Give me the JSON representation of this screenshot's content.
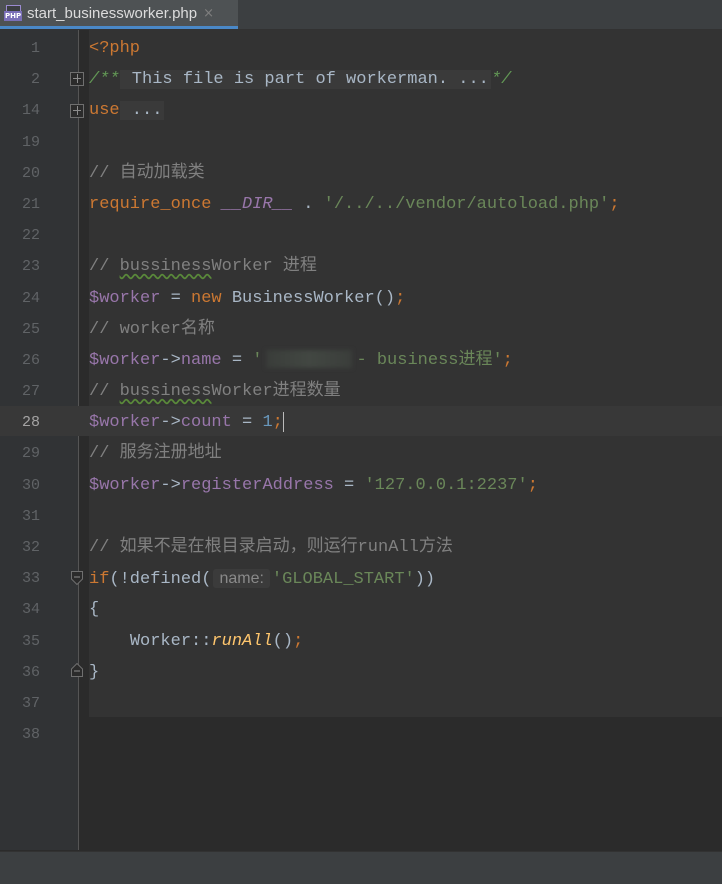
{
  "tab": {
    "file_icon": "php-file-icon",
    "icon_label": "PHP",
    "title": "start_businessworker.php",
    "close": "×"
  },
  "editor": {
    "current_line": "28",
    "lines": [
      {
        "num": "1"
      },
      {
        "num": "2"
      },
      {
        "num": "14"
      },
      {
        "num": "19"
      },
      {
        "num": "20"
      },
      {
        "num": "21"
      },
      {
        "num": "22"
      },
      {
        "num": "23"
      },
      {
        "num": "24"
      },
      {
        "num": "25"
      },
      {
        "num": "26"
      },
      {
        "num": "27"
      },
      {
        "num": "28"
      },
      {
        "num": "29"
      },
      {
        "num": "30"
      },
      {
        "num": "31"
      },
      {
        "num": "32"
      },
      {
        "num": "33"
      },
      {
        "num": "34"
      },
      {
        "num": "35"
      },
      {
        "num": "36"
      },
      {
        "num": "37"
      },
      {
        "num": "38"
      }
    ],
    "code": {
      "l1": "<?php",
      "l2_open": "/**",
      "l2_text": " This file is part of workerman. ...",
      "l2_close": "*/",
      "l3_kw": "use",
      "l3_fold": " ...",
      "l5": "// 自动加载类",
      "l6_kw": "require_once",
      "l6_const": "__DIR__",
      "l6_dot": " . ",
      "l6_str": "'/../../vendor/autoload.php'",
      "l6_semi": ";",
      "l8_pre": "// ",
      "l8_squig": "bussiness",
      "l8_post": "Worker 进程",
      "l9_var": "$worker",
      "l9_eq": " = ",
      "l9_new": "new",
      "l9_cls": " BusinessWorker()",
      "l9_semi": ";",
      "l10": "// worker名称",
      "l11_var": "$worker",
      "l11_arrow": "->",
      "l11_prop": "name",
      "l11_eq": " = ",
      "l11_q": "'",
      "l11_str": "- business进程'",
      "l11_semi": ";",
      "l12_pre": "// ",
      "l12_squig": "bussiness",
      "l12_post": "Worker进程数量",
      "l13_var": "$worker",
      "l13_arrow": "->",
      "l13_prop": "count",
      "l13_eq": " = ",
      "l13_num": "1",
      "l13_semi": ";",
      "l14": "// 服务注册地址",
      "l15_var": "$worker",
      "l15_arrow": "->",
      "l15_prop": "registerAddress",
      "l15_eq": " = ",
      "l15_str": "'127.0.0.1:2237'",
      "l15_semi": ";",
      "l17": "// 如果不是在根目录启动，则运行runAll方法",
      "l18_kw": "if",
      "l18_a": "(!defined(",
      "l18_hint": "name:",
      "l18_str": "'GLOBAL_START'",
      "l18_b": "))",
      "l19": "{",
      "l20_indent": "    ",
      "l20_cls": "Worker::",
      "l20_fn": "runAll",
      "l20_paren": "()",
      "l20_semi": ";",
      "l21": "}"
    }
  }
}
